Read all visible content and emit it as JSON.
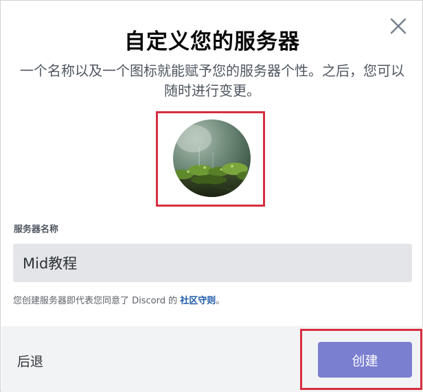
{
  "dialog": {
    "title": "自定义您的服务器",
    "subtitle": "一个名称以及一个图标就能赋予您的服务器个性。之后，您可以随时进行变更。",
    "close_icon": "close-icon"
  },
  "server_name": {
    "label": "服务器名称",
    "value": "Mid教程"
  },
  "terms": {
    "prefix": "您创建服务器即代表您同意了 Discord 的 ",
    "link": "社区守则",
    "suffix": "。"
  },
  "footer": {
    "back_label": "后退",
    "create_label": "创建"
  },
  "colors": {
    "accent": "#7a7fd0",
    "highlight": "#d62d3f",
    "link": "#1d5aa8"
  }
}
